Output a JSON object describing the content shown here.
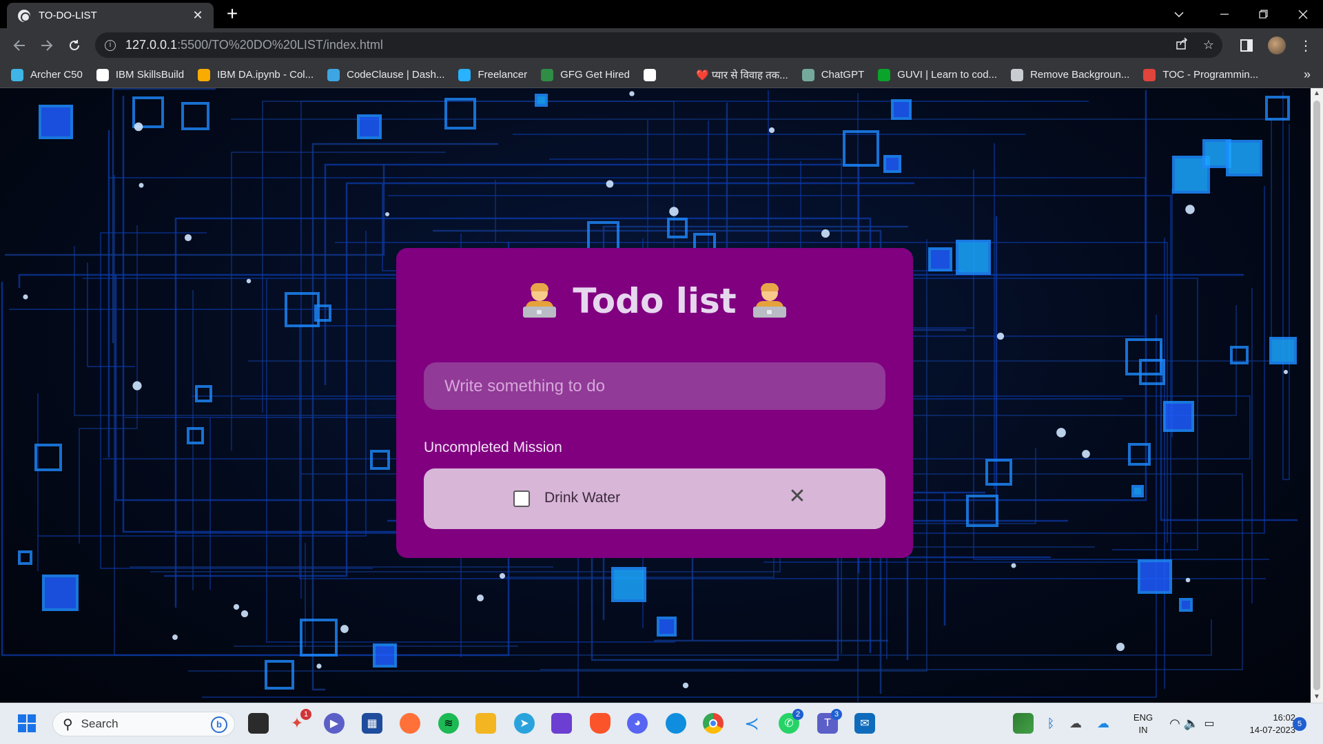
{
  "browser": {
    "tab_title": "TO-DO-LIST",
    "tab_close": "✕",
    "new_tab": "+",
    "url_host": "127.0.0.1",
    "url_path": ":5500/TO%20DO%20LIST/index.html",
    "bookmarks": [
      {
        "label": "Archer C50",
        "icon_color": "#3fb5e5"
      },
      {
        "label": "IBM SkillsBuild",
        "icon_color": "#ffffff"
      },
      {
        "label": "IBM DA.ipynb - Col...",
        "icon_color": "#f9ab00"
      },
      {
        "label": "CodeClause | Dash...",
        "icon_color": "#3da6e2"
      },
      {
        "label": "Freelancer",
        "icon_color": "#29b2fe"
      },
      {
        "label": "GFG Get Hired",
        "icon_color": "#2f8d46"
      },
      {
        "label": "",
        "icon_color": "#ffffff"
      },
      {
        "label": "❤️ प्यार से विवाह तक...",
        "icon_color": "#35363a"
      },
      {
        "label": "ChatGPT",
        "icon_color": "#74aa9c"
      },
      {
        "label": "GUVI | Learn to cod...",
        "icon_color": "#0aa42b"
      },
      {
        "label": "Remove Backgroun...",
        "icon_color": "#c9ccd1"
      },
      {
        "label": "TOC - Programmin...",
        "icon_color": "#e0443a"
      }
    ],
    "bookmarks_more": "»"
  },
  "app": {
    "title": "Todo list",
    "input_placeholder": "Write something to do",
    "section_label": "Uncompleted Mission",
    "tasks": [
      {
        "text": "Drink Water",
        "completed": false
      }
    ],
    "delete_symbol": "✕",
    "card_color": "#800080",
    "task_bg_color": "#d8b6d8"
  },
  "taskbar": {
    "search_label": "Search",
    "apps": [
      {
        "name": "windows-start-icon"
      },
      {
        "name": "task-view-icon"
      },
      {
        "name": "app-with-notification-icon",
        "badge": "1"
      },
      {
        "name": "meet-icon"
      },
      {
        "name": "store-icon"
      },
      {
        "name": "firefox-icon"
      },
      {
        "name": "spotify-icon"
      },
      {
        "name": "file-explorer-icon"
      },
      {
        "name": "telegram-icon"
      },
      {
        "name": "clapper-icon"
      },
      {
        "name": "brave-icon"
      },
      {
        "name": "discord-icon"
      },
      {
        "name": "edge-icon"
      },
      {
        "name": "chrome-icon"
      },
      {
        "name": "vscode-icon"
      },
      {
        "name": "whatsapp-icon",
        "badge": "2"
      },
      {
        "name": "teams-icon",
        "badge": "3"
      },
      {
        "name": "mail-icon"
      }
    ],
    "language_line1": "ENG",
    "language_line2": "IN",
    "time": "16:02",
    "date": "14-07-2023",
    "notification_count": "5"
  }
}
